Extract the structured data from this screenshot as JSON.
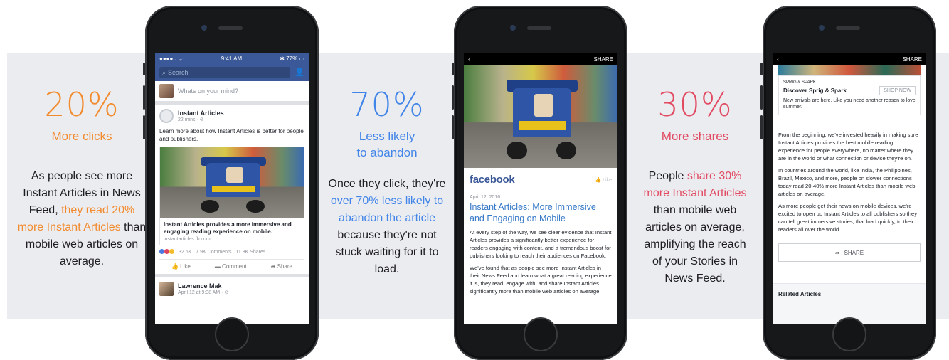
{
  "colors": {
    "orange": "#f28b2e",
    "blue": "#4285e8",
    "pink": "#e24a62",
    "band": "#ebecf0",
    "facebook_blue": "#3b5998"
  },
  "stats": [
    {
      "pct": "20%",
      "sub_lines": [
        "More clicks"
      ],
      "body_pre": "As people see more Instant Articles in News Feed, ",
      "body_hl": "they read 20% more Instant Articles",
      "body_post": " than mobile web articles on average."
    },
    {
      "pct": "70%",
      "sub_lines": [
        "Less likely",
        "to abandon"
      ],
      "body_pre": "Once they click, they're ",
      "body_hl": "over 70% less likely to abandon the article",
      "body_post": " because they're not stuck waiting for it to load."
    },
    {
      "pct": "30%",
      "sub_lines": [
        "More shares"
      ],
      "body_pre": "People ",
      "body_hl": "share 30% more Instant Articles",
      "body_post": " than mobile web articles on average, amplifying the reach of your Stories in News Feed."
    }
  ],
  "phone1": {
    "status_left": "●●●●○ ᯤ",
    "time": "9:41 AM",
    "battery": "✱ 77% ▭",
    "search_placeholder": "Search",
    "composer_prompt": "Whats on your mind?",
    "post": {
      "author": "Instant Articles",
      "time": "22 mins · ⊘",
      "text": "Learn more about how Instant Articles is better for people and publishers.",
      "card_title": "Instant Articles provides a more immersive and engaging reading experience on mobile.",
      "card_url": "instantarticles.fb.com",
      "reactions": "32.6K",
      "comments": "7.9K Comments",
      "shares": "11.3K Shares",
      "actions": [
        "Like",
        "Comment",
        "Share"
      ]
    },
    "post2": {
      "author": "Lawrence Mak",
      "time": "April 12 at 9:38 AM · ⊘"
    }
  },
  "phone2": {
    "share_label": "SHARE",
    "brand": "facebook",
    "like": "Like",
    "date": "April 12, 2016",
    "title": "Instant Articles: More Immersive and Engaging on Mobile",
    "paragraphs": [
      "At every step of the way, we see clear evidence that Instant Articles provides a significantly better experience for readers engaging with content, and a tremendous boost for publishers looking to reach their audiences on Facebook.",
      "We've found that as people see more Instant Articles in their News Feed and learn what a great reading experience it is, they read, engage with, and share Instant Articles significantly more than mobile web articles on average."
    ]
  },
  "phone3": {
    "share_label": "SHARE",
    "ad": {
      "label": "SPRIG & SPARK",
      "name": "Discover Sprig & Spark",
      "button": "SHOP NOW",
      "copy": "New arrivals are here. Like you need another reason to love summer."
    },
    "paragraphs": [
      "From the beginning, we've invested heavily in making sure Instant Articles provides the best mobile reading experience for people everywhere, no matter where they are in the world or what connection or device they're on.",
      "In countries around the world, like India, the Philippines, Brazil, Mexico, and more, people on slower connections today read 20-40% more Instant Articles than mobile web articles on average.",
      "As more people get their news on mobile devices, we're excited to open up Instant Articles to all publishers so they can tell great immersive stories, that load quickly, to their readers all over the world."
    ],
    "share_button": "SHARE",
    "related": "Related Articles"
  }
}
